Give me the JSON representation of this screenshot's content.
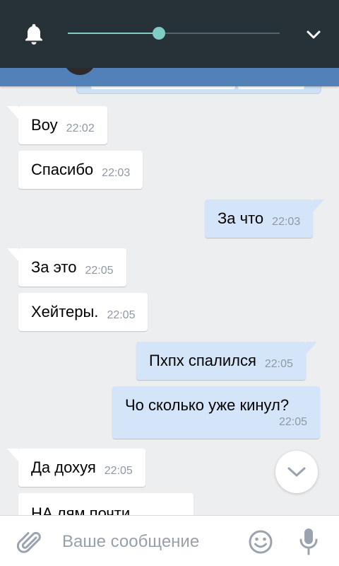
{
  "composer": {
    "placeholder": "Ваше сообщение"
  },
  "volume": {
    "level": 0.43
  },
  "messages": [
    {
      "id": "m1",
      "side": "in",
      "text": "Воу",
      "time": "22:02"
    },
    {
      "id": "m2",
      "side": "in",
      "text": "Спасибо",
      "time": "22:03"
    },
    {
      "id": "m3",
      "side": "out",
      "text": "За что",
      "time": "22:03"
    },
    {
      "id": "m4",
      "side": "in",
      "text": "За это",
      "time": "22:05"
    },
    {
      "id": "m5",
      "side": "in",
      "text": "Хейтеры.",
      "time": "22:05"
    },
    {
      "id": "m6",
      "side": "out",
      "text": "Пхпх спалился",
      "time": "22:05"
    },
    {
      "id": "m7",
      "side": "out",
      "text": "Чо сколько уже кинул?",
      "time": "22:05"
    },
    {
      "id": "m8",
      "side": "in",
      "text": "Да дохуя",
      "time": "22:05"
    },
    {
      "id": "m9",
      "side": "in",
      "text": "НА лям почти",
      "time": ""
    }
  ],
  "colors": {
    "panel": "#263238",
    "accent": "#80cbc4",
    "app_bar": "#5181b8",
    "chat_bg": "#edeef0",
    "out_bubble": "#d4e5fa",
    "in_bubble": "#ffffff"
  },
  "icons": {
    "bell": "bell-icon",
    "expand": "chevron-down-icon",
    "scroll": "chevron-down-icon",
    "attach": "paperclip-icon",
    "emoji": "smiley-icon",
    "mic": "microphone-icon"
  }
}
